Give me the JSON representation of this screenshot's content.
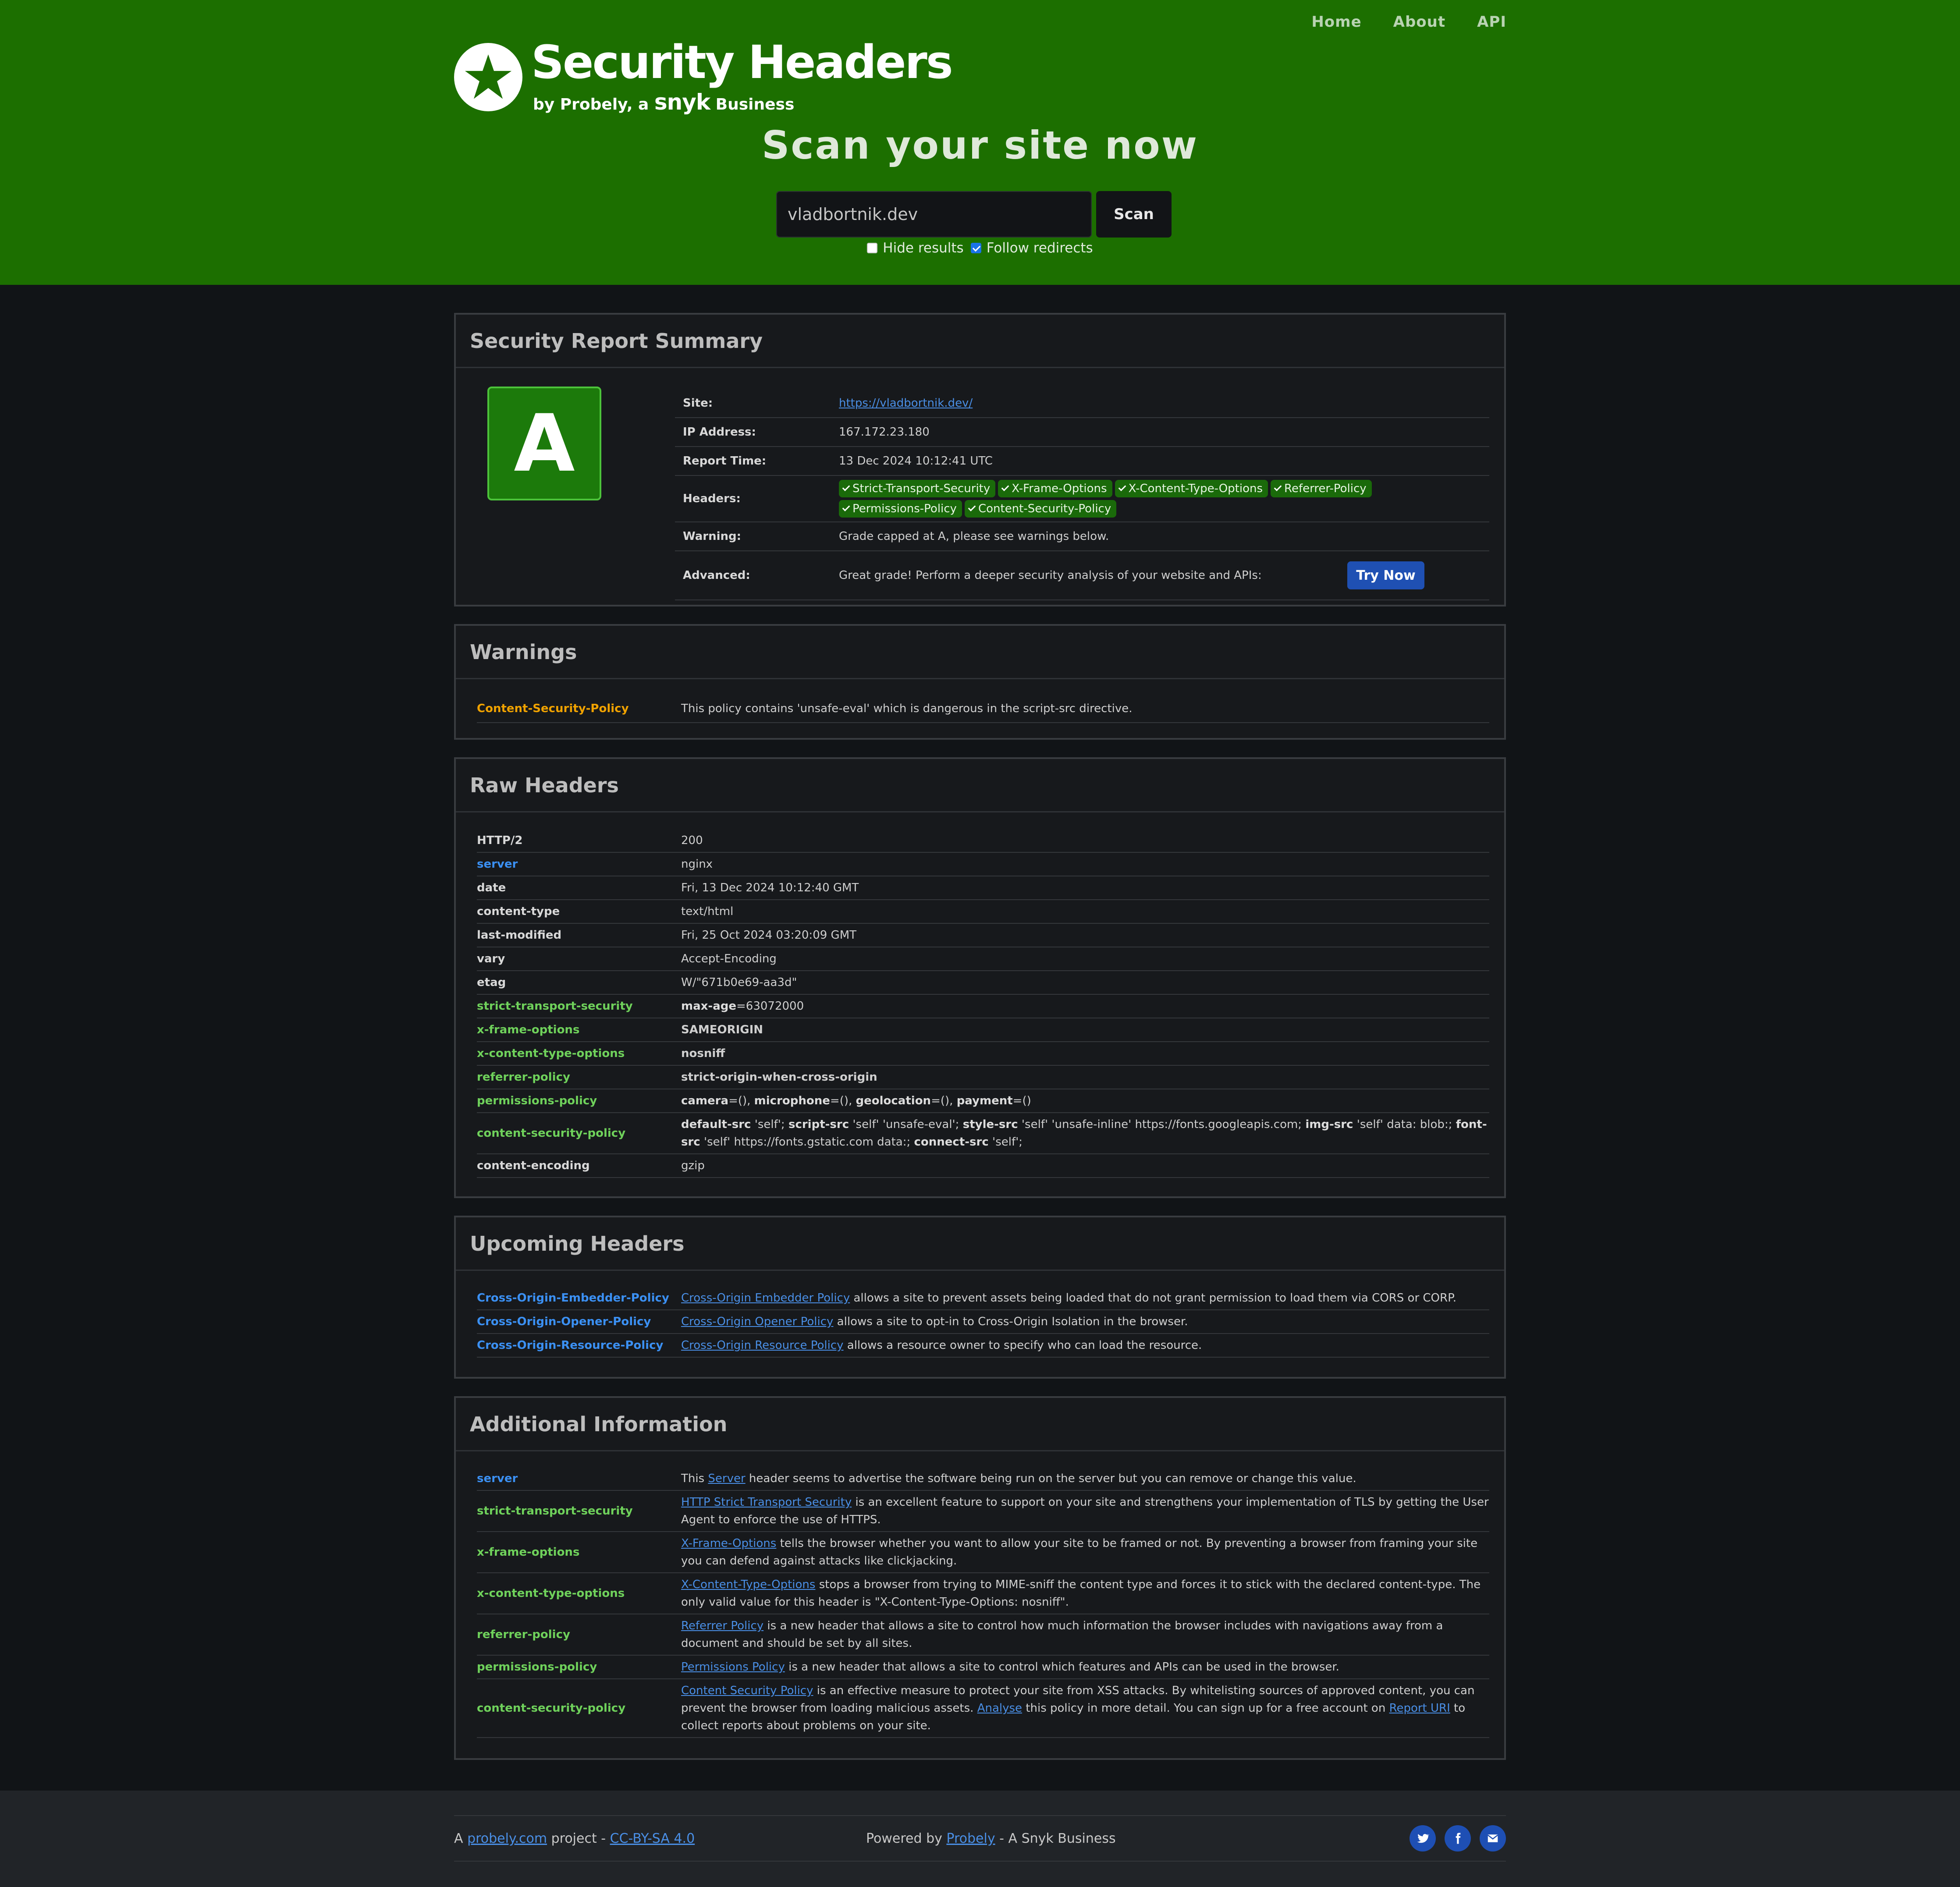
{
  "nav": {
    "home": "Home",
    "about": "About",
    "api": "API"
  },
  "logo": {
    "title": "Security Headers",
    "by": "by Probely, a",
    "snyk": "snyk",
    "business": "Business"
  },
  "scan": {
    "title": "Scan your site now",
    "value": "vladbortnik.dev",
    "button": "Scan",
    "hide_label": "Hide results",
    "follow_label": "Follow redirects",
    "hide_checked": false,
    "follow_checked": true
  },
  "summary": {
    "heading": "Security Report Summary",
    "grade": "A",
    "site_label": "Site:",
    "site": "https://vladbortnik.dev/",
    "ip_label": "IP Address:",
    "ip": "167.172.23.180",
    "time_label": "Report Time:",
    "time": "13 Dec 2024 10:12:41 UTC",
    "headers_label": "Headers:",
    "headers": [
      "Strict-Transport-Security",
      "X-Frame-Options",
      "X-Content-Type-Options",
      "Referrer-Policy",
      "Permissions-Policy",
      "Content-Security-Policy"
    ],
    "warning_label": "Warning:",
    "warning": "Grade capped at A, please see warnings below.",
    "advanced_label": "Advanced:",
    "advanced": "Great grade! Perform a deeper security analysis of your website and APIs:",
    "try_now": "Try Now"
  },
  "warnings": {
    "heading": "Warnings",
    "rows": [
      {
        "name": "Content-Security-Policy",
        "text": "This policy contains 'unsafe-eval' which is dangerous in the script-src directive."
      }
    ]
  },
  "raw": {
    "heading": "Raw Headers",
    "rows": [
      {
        "name": "HTTP/2",
        "value": "200"
      },
      {
        "name": "server",
        "value": "nginx"
      },
      {
        "name": "date",
        "value": "Fri, 13 Dec 2024 10:12:40 GMT"
      },
      {
        "name": "content-type",
        "value": "text/html"
      },
      {
        "name": "last-modified",
        "value": "Fri, 25 Oct 2024 03:20:09 GMT"
      },
      {
        "name": "vary",
        "value": "Accept-Encoding"
      },
      {
        "name": "etag",
        "value": "W/\"671b0e69-aa3d\""
      },
      {
        "name": "strict-transport-security",
        "value": "max-age=63072000"
      },
      {
        "name": "x-frame-options",
        "value": "SAMEORIGIN"
      },
      {
        "name": "x-content-type-options",
        "value": "nosniff"
      },
      {
        "name": "referrer-policy",
        "value": "strict-origin-when-cross-origin"
      },
      {
        "name": "permissions-policy",
        "value": "camera=(), microphone=(), geolocation=(), payment=()"
      },
      {
        "name": "content-security-policy",
        "value": "default-src 'self'; script-src 'self' 'unsafe-eval'; style-src 'self' 'unsafe-inline' https://fonts.googleapis.com; img-src 'self' data: blob:; font-src 'self' https://fonts.gstatic.com data:; connect-src 'self';"
      },
      {
        "name": "content-encoding",
        "value": "gzip"
      }
    ]
  },
  "upcoming": {
    "heading": "Upcoming Headers",
    "rows": [
      {
        "name": "Cross-Origin-Embedder-Policy",
        "link": "Cross-Origin Embedder Policy",
        "text": " allows a site to prevent assets being loaded that do not grant permission to load them via CORS or CORP."
      },
      {
        "name": "Cross-Origin-Opener-Policy",
        "link": "Cross-Origin Opener Policy",
        "text": " allows a site to opt-in to Cross-Origin Isolation in the browser."
      },
      {
        "name": "Cross-Origin-Resource-Policy",
        "link": "Cross-Origin Resource Policy",
        "text": " allows a resource owner to specify who can load the resource."
      }
    ]
  },
  "additional": {
    "heading": "Additional Information",
    "server": {
      "name": "server",
      "pre": "This ",
      "link": "Server",
      "text": " header seems to advertise the software being run on the server but you can remove or change this value."
    },
    "hsts": {
      "name": "strict-transport-security",
      "link": "HTTP Strict Transport Security",
      "text": " is an excellent feature to support on your site and strengthens your implementation of TLS by getting the User Agent to enforce the use of HTTPS."
    },
    "xfo": {
      "name": "x-frame-options",
      "link": "X-Frame-Options",
      "text": " tells the browser whether you want to allow your site to be framed or not. By preventing a browser from framing your site you can defend against attacks like clickjacking."
    },
    "xcto": {
      "name": "x-content-type-options",
      "link": "X-Content-Type-Options",
      "text": " stops a browser from trying to MIME-sniff the content type and forces it to stick with the declared content-type. The only valid value for this header is \"X-Content-Type-Options: nosniff\"."
    },
    "rp": {
      "name": "referrer-policy",
      "link": "Referrer Policy",
      "text": " is a new header that allows a site to control how much information the browser includes with navigations away from a document and should be set by all sites."
    },
    "pp": {
      "name": "permissions-policy",
      "link": "Permissions Policy",
      "text": " is a new header that allows a site to control which features and APIs can be used in the browser."
    },
    "csp": {
      "name": "content-security-policy",
      "link": "Content Security Policy",
      "text1": " is an effective measure to protect your site from XSS attacks. By whitelisting sources of approved content, you can prevent the browser from loading malicious assets. ",
      "link2": "Analyse",
      "text2": " this policy in more detail. You can sign up for a free account on ",
      "link3": "Report URI",
      "text3": " to collect reports about problems on your site."
    }
  },
  "footer": {
    "a": "A ",
    "probely": "probely.com",
    "project": " project - ",
    "license": "CC-BY-SA 4.0",
    "powered": "Powered by ",
    "probely2": "Probely",
    "snyk_business": " - A Snyk Business"
  },
  "colors": {
    "header_green": "#1c6f00",
    "grade_green": "#1c7a0b",
    "link_blue": "#4a8fe6",
    "warning_orange": "#f0a200"
  }
}
